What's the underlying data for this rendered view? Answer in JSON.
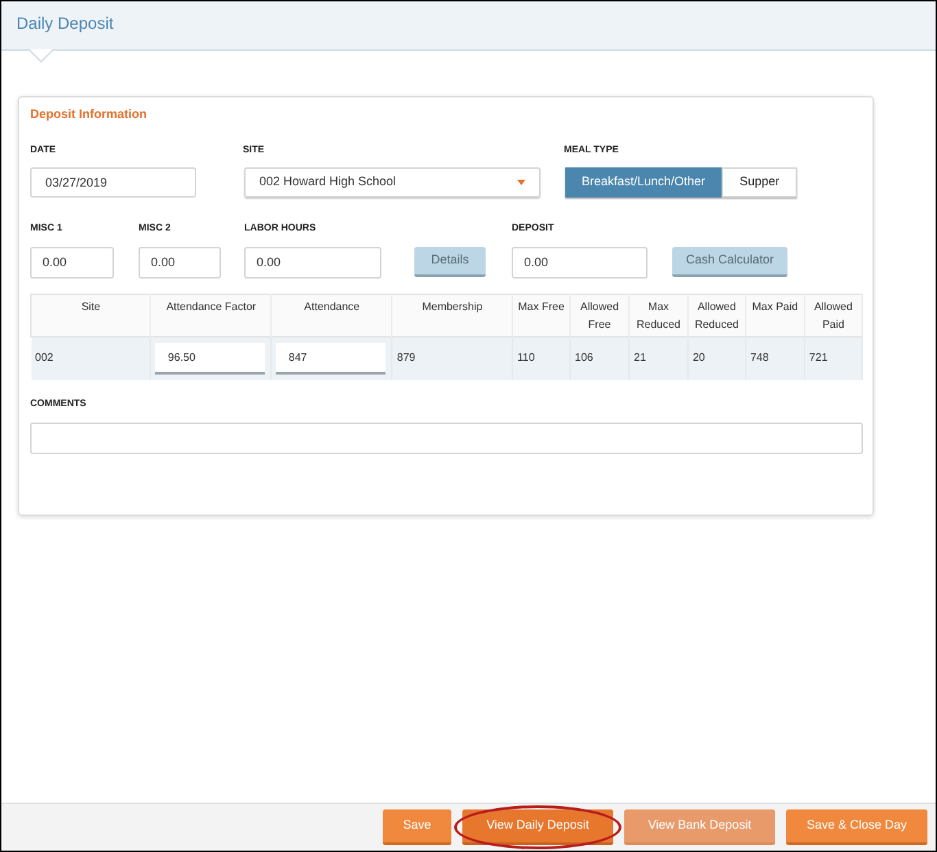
{
  "page_title": "Daily Deposit",
  "section_title": "Deposit Information",
  "date": {
    "label": "DATE",
    "value": "03/27/2019"
  },
  "site": {
    "label": "SITE",
    "value": "002 Howard High School"
  },
  "meal_type": {
    "label": "MEAL TYPE",
    "options": [
      {
        "label": "Breakfast/Lunch/Other",
        "selected": true
      },
      {
        "label": "Supper",
        "selected": false
      }
    ]
  },
  "misc1": {
    "label": "MISC 1",
    "value": "0.00"
  },
  "misc2": {
    "label": "MISC 2",
    "value": "0.00"
  },
  "labor_hours": {
    "label": "LABOR HOURS",
    "value": "0.00"
  },
  "details_button": {
    "label": "Details"
  },
  "deposit": {
    "label": "DEPOSIT",
    "value": "0.00"
  },
  "cash_calculator_button": {
    "label": "Cash Calculator"
  },
  "table": {
    "columns": [
      "Site",
      "Attendance Factor",
      "Attendance",
      "Membership",
      "Max Free",
      "Allowed Free",
      "Max Reduced",
      "Allowed Reduced",
      "Max Paid",
      "Allowed Paid"
    ],
    "rows": [
      [
        {
          "kind": "text",
          "value": "002"
        },
        {
          "kind": "input",
          "value": "96.50"
        },
        {
          "kind": "input",
          "value": "847"
        },
        {
          "kind": "text",
          "value": "879"
        },
        {
          "kind": "text",
          "value": "110"
        },
        {
          "kind": "text",
          "value": "106"
        },
        {
          "kind": "text",
          "value": "21"
        },
        {
          "kind": "text",
          "value": "20"
        },
        {
          "kind": "text",
          "value": "748"
        },
        {
          "kind": "text",
          "value": "721"
        }
      ]
    ]
  },
  "comments": {
    "label": "COMMENTS"
  },
  "footer_buttons": [
    {
      "label": "Save",
      "disabled": false,
      "highlighted": false
    },
    {
      "label": "View Daily Deposit",
      "disabled": false,
      "highlighted": true
    },
    {
      "label": "View Bank Deposit",
      "disabled": true,
      "highlighted": false
    },
    {
      "label": "Save & Close Day",
      "disabled": false,
      "highlighted": false
    }
  ]
}
